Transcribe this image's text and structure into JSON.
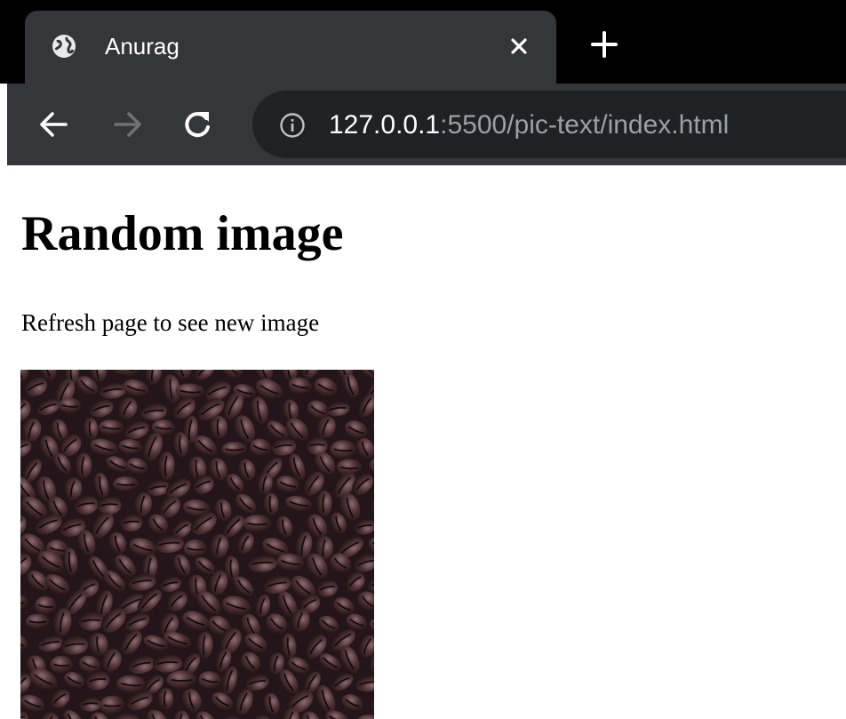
{
  "browser": {
    "tab": {
      "title": "Anurag",
      "favicon": "globe-icon",
      "close": "close-icon"
    },
    "new_tab": "plus-icon",
    "nav": {
      "back": "arrow-left-icon",
      "forward": "arrow-right-icon",
      "reload": "reload-icon"
    },
    "address": {
      "info_icon": "info-icon",
      "host": "127.0.0.1",
      "rest": ":5500/pic-text/index.html"
    }
  },
  "page": {
    "heading": "Random image",
    "text": "Refresh page to see new image",
    "image": "coffee-beans-photo"
  },
  "colors": {
    "tab_strip": "#000000",
    "toolbar": "#35363a",
    "omnibox": "#202124",
    "url_dim": "#9aa0a6"
  }
}
